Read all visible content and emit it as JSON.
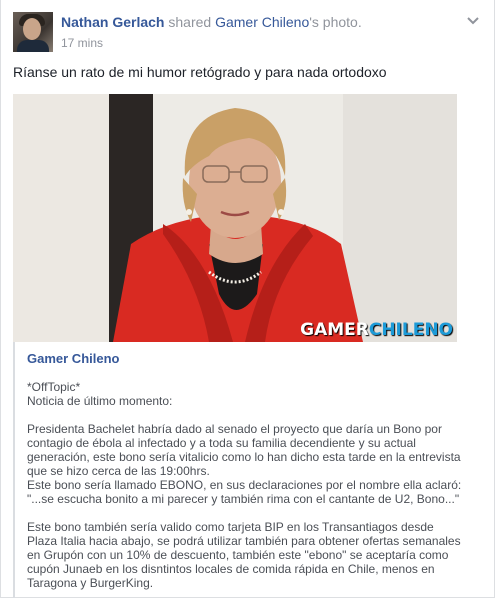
{
  "post": {
    "author": "Nathan Gerlach",
    "action": "shared",
    "page_name": "Gamer Chileno",
    "possessive": "'s photo.",
    "time": "17 mins",
    "status_text": "Ríanse un rato de mi humor retógrado y para nada ortodoxo",
    "menu_icon": "chevron-down-icon"
  },
  "photo": {
    "watermark_a": "GAMER",
    "watermark_b": "CHILENO",
    "colors": {
      "jacket": "#d92a22",
      "watermark_blue": "#1d9bd8"
    }
  },
  "shared_post": {
    "page_name": "Gamer Chileno",
    "line_offtopic": "*OffTopic*",
    "line_news": "Noticia de último momento:",
    "para1": "Presidenta Bachelet habría dado al senado el proyecto que daría un Bono por contagio de ébola al infectado y a toda su familia decendiente y su actual generación, este bono sería vitalicio como lo han dicho esta tarde en la entrevista que se hizo cerca de las 19:00hrs.",
    "para2a": "Este bono sería llamado EBONO, en sus declaraciones por el nombre ella aclaró:",
    "para2b": "\"...se escucha bonito a mi parecer y también rima con el cantante de U2, Bono...\"",
    "para3": "Este bono también sería valido como tarjeta BIP en los Transantiagos desde Plaza Italia hacia abajo, se podrá utilizar también para obtener ofertas semanales en Grupón con un 10% de descuento, también este \"ebono\" se aceptaría como cupón Junaeb en los disntintos locales de comida rápida en Chile, menos en Taragona y BurgerKing."
  },
  "colors": {
    "link": "#365899",
    "meta": "#90949c",
    "text": "#1d2129",
    "shared_text": "#4b4f56"
  }
}
